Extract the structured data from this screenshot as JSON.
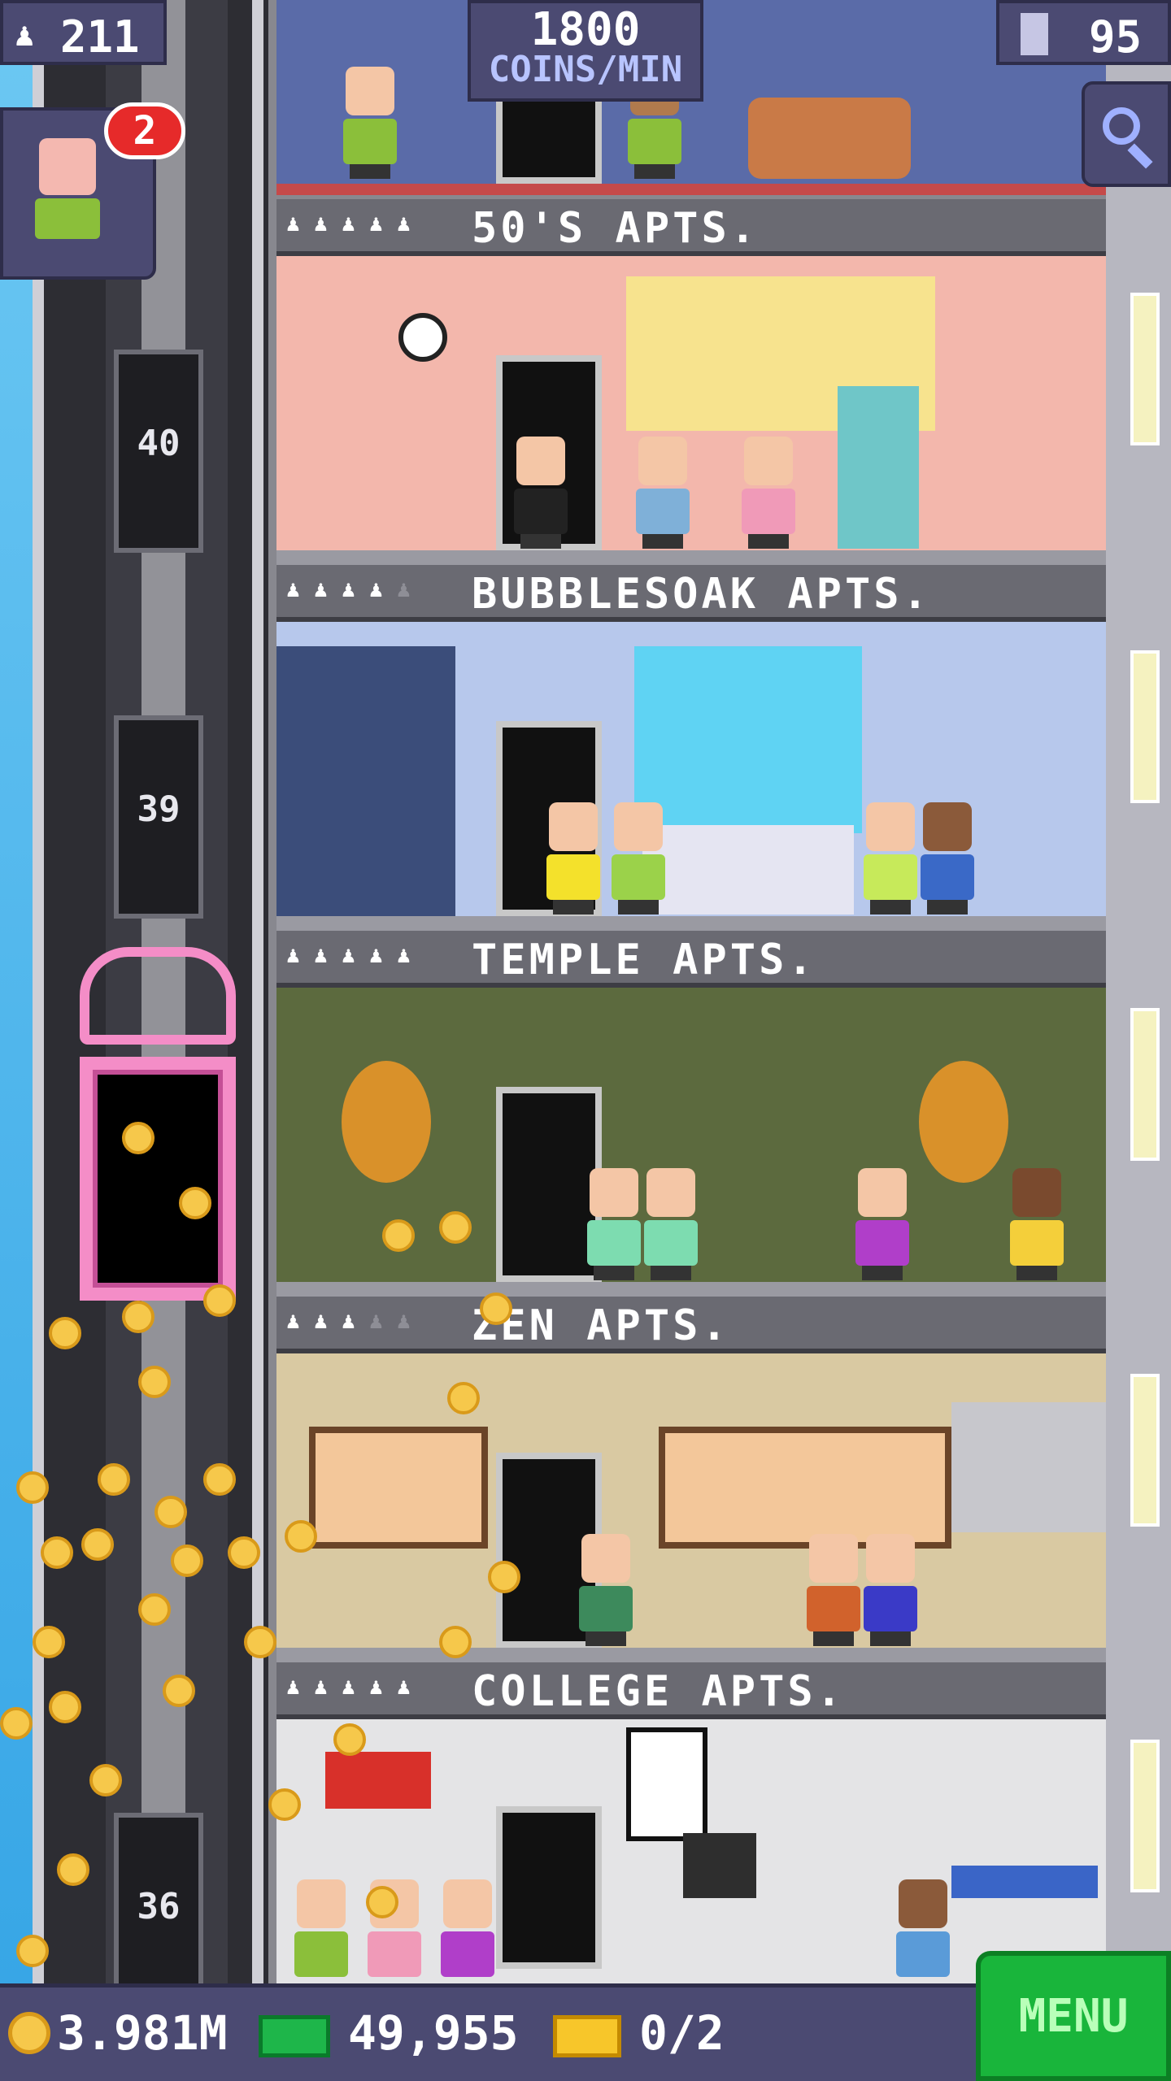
{
  "hud": {
    "population": "211",
    "coins_per_min_value": "1800",
    "coins_per_min_label": "COINS/MIN",
    "floors": "95",
    "notification_count": "2"
  },
  "elevator": {
    "floor_numbers": [
      "40",
      "39",
      "36"
    ]
  },
  "floors": [
    {
      "name": "50'S APTS.",
      "stars": 5
    },
    {
      "name": "BUBBLESOAK APTS.",
      "stars": 4
    },
    {
      "name": "TEMPLE APTS.",
      "stars": 5
    },
    {
      "name": "ZEN APTS.",
      "stars": 3
    },
    {
      "name": "COLLEGE APTS.",
      "stars": 5
    }
  ],
  "bottom": {
    "coins": "3.981M",
    "bux": "49,955",
    "tickets": "0/2",
    "menu_label": "MENU"
  }
}
